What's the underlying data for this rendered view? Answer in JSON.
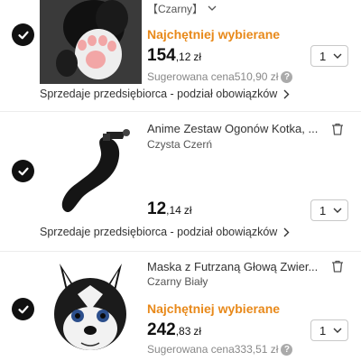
{
  "items": [
    {
      "variant": "【Czarny】",
      "badge": "Najchętniej wybierane",
      "price_int": "154",
      "price_dec": ",12",
      "currency": "zł",
      "suggested_price": "Sugerowana cena510,90 zł",
      "quantity": "1",
      "seller_note": "Sprzedaje przedsiębiorca - podział obowiązków"
    },
    {
      "title": "Anime Zestaw Ogonów Kotka, ...",
      "variant": "Czysta Czerń",
      "price_int": "12",
      "price_dec": ",14",
      "currency": "zł",
      "quantity": "1",
      "seller_note": "Sprzedaje przedsiębiorca - podział obowiązków"
    },
    {
      "title": "Maska z Futrzaną Głową Zwier...",
      "variant": "Czarny Biały",
      "badge": "Najchętniej wybierane",
      "price_int": "242",
      "price_dec": ",83",
      "currency": "zł",
      "suggested_price": "Sugerowana cena333,51 zł",
      "quantity": "1"
    }
  ],
  "icons": {
    "selected": "check-circle-icon",
    "delete": "trash-icon",
    "dropdown": "chevron-down-icon",
    "next": "chevron-right-icon",
    "info": "question-icon"
  },
  "colors": {
    "badge": "#e8891a",
    "check_bg": "#111111",
    "muted": "#888888"
  }
}
